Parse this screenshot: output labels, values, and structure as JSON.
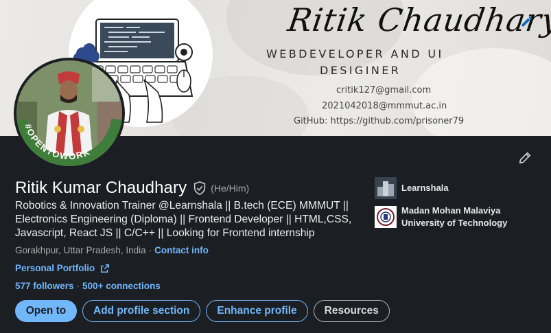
{
  "banner": {
    "signature": "Ritik Chaudhary",
    "role_line1": "WEBDEVELOPER AND UI",
    "role_line2": "DESIGINER",
    "email1": "critik127@gmail.com",
    "email2": "2021042018@mmmut.ac.in",
    "github": "GitHub: https://github.com/prisoner79"
  },
  "avatar": {
    "badge_text": "#OPENTOWORK",
    "badge_color": "#3f7d3a"
  },
  "profile": {
    "name": "Ritik Kumar Chaudhary",
    "pronouns": "(He/Him)",
    "headline": "Robotics & Innovation Trainer @Learnshala || B.tech (ECE) MMMUT || Electronics Engineering (Diploma) || Frontend Developer || HTML,CSS, Javascript, React JS || C/C++ || Looking for Frontend internship",
    "location": "Gorakhpur, Uttar Pradesh, India",
    "contact_info": "Contact info",
    "portfolio": "Personal Portfolio",
    "followers": "577 followers",
    "connections": "500+ connections"
  },
  "actions": {
    "open_to": "Open to",
    "add_section": "Add profile section",
    "enhance": "Enhance profile",
    "resources": "Resources"
  },
  "orgs": {
    "company": "Learnshala",
    "school_line1": "Madan Mohan Malaviya",
    "school_line2": "University of Technology"
  },
  "colors": {
    "background": "#1b1f23",
    "accent": "#71b7fb",
    "open_to_work": "#3f7d3a"
  }
}
